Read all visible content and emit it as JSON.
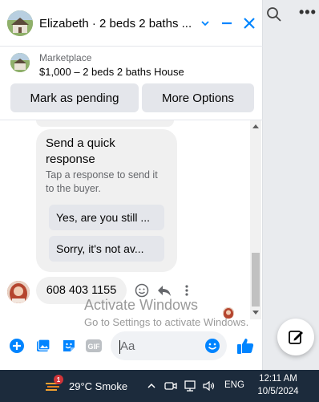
{
  "header": {
    "title": "Elizabeth · 2 beds 2 baths ...",
    "icons": [
      "chevron-down-icon",
      "minimize-icon",
      "close-icon"
    ]
  },
  "listing": {
    "label": "Marketplace",
    "title": "$1,000 – 2 beds 2 baths House"
  },
  "actions": {
    "mark_pending": "Mark as pending",
    "more_options": "More Options"
  },
  "quick_response": {
    "title": "Send a quick response",
    "subtitle": "Tap a response to send it to the buyer.",
    "options": [
      "Yes, are you still ...",
      "Sorry, it's not av..."
    ]
  },
  "last_message": {
    "text": "608 403 1155"
  },
  "composer": {
    "placeholder": "Aa"
  },
  "watermark": {
    "title": "Activate Windows",
    "subtitle": "Go to Settings to activate Windows."
  },
  "taskbar": {
    "weather_badge": "1",
    "weather": "29°C  Smoke",
    "language": "ENG",
    "time": "12:11 AM",
    "date": "10/5/2024"
  },
  "colors": {
    "accent": "#0084ff",
    "bubble": "#f0f0f0",
    "button": "#e4e6eb",
    "taskbar": "#1c2b3c"
  }
}
